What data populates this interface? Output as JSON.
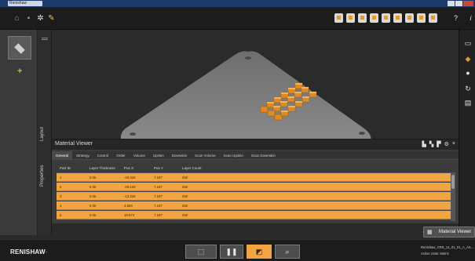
{
  "window": {
    "title": "Renishaw QuantAM"
  },
  "toolbar": {
    "icons": [
      "home-icon",
      "save-icon",
      "gear-icon",
      "tools-icon"
    ],
    "view_icons": [
      "view-iso-icon",
      "view-front-icon",
      "view-back-icon",
      "view-left-icon",
      "view-right-icon",
      "view-top-icon",
      "view-bottom-icon",
      "render-icon",
      "fit-icon"
    ],
    "help_label": "?",
    "info_label": "i"
  },
  "left_panel": {
    "add_label": "+",
    "tabs": [
      "Properties",
      "Layout"
    ]
  },
  "material_viewer": {
    "title": "Material Viewer",
    "tabs": [
      "General",
      "Strategy",
      "Control",
      "Order",
      "Volume",
      "Upskin",
      "Downskin",
      "Scan Volume",
      "Scan Upskin",
      "Scan Downskin"
    ],
    "active_tab": "General",
    "columns": [
      "Part ID",
      "Layer Thickness",
      "Pos X",
      "Pos Y",
      "Layer Count"
    ],
    "rows": [
      [
        "1",
        "0.06",
        "-43.316",
        "7.187",
        "250"
      ],
      [
        "2",
        "0.06",
        "-28.126",
        "7.187",
        "250"
      ],
      [
        "3",
        "0.06",
        "-13.316",
        "7.187",
        "250"
      ],
      [
        "4",
        "0.06",
        "3.694",
        "7.187",
        "250"
      ],
      [
        "5",
        "0.06",
        "18.674",
        "7.187",
        "250"
      ]
    ]
  },
  "material_viewer_button": {
    "label": "Material Viewer"
  },
  "bottom": {
    "logo": "RENISHAW",
    "workflow_steps": [
      "layout-step",
      "support-step",
      "build-prep-step",
      "review-step"
    ],
    "active_step": "build-prep-step",
    "file_name": "Renishaw_CRS_14_01_01_A_AS...",
    "status": "Active Units: Metric"
  },
  "colors": {
    "accent": "#f2a442",
    "row_border": "#c27c24",
    "toolbar": "#1c1c1c",
    "titlebar": "#1a3a6a"
  }
}
